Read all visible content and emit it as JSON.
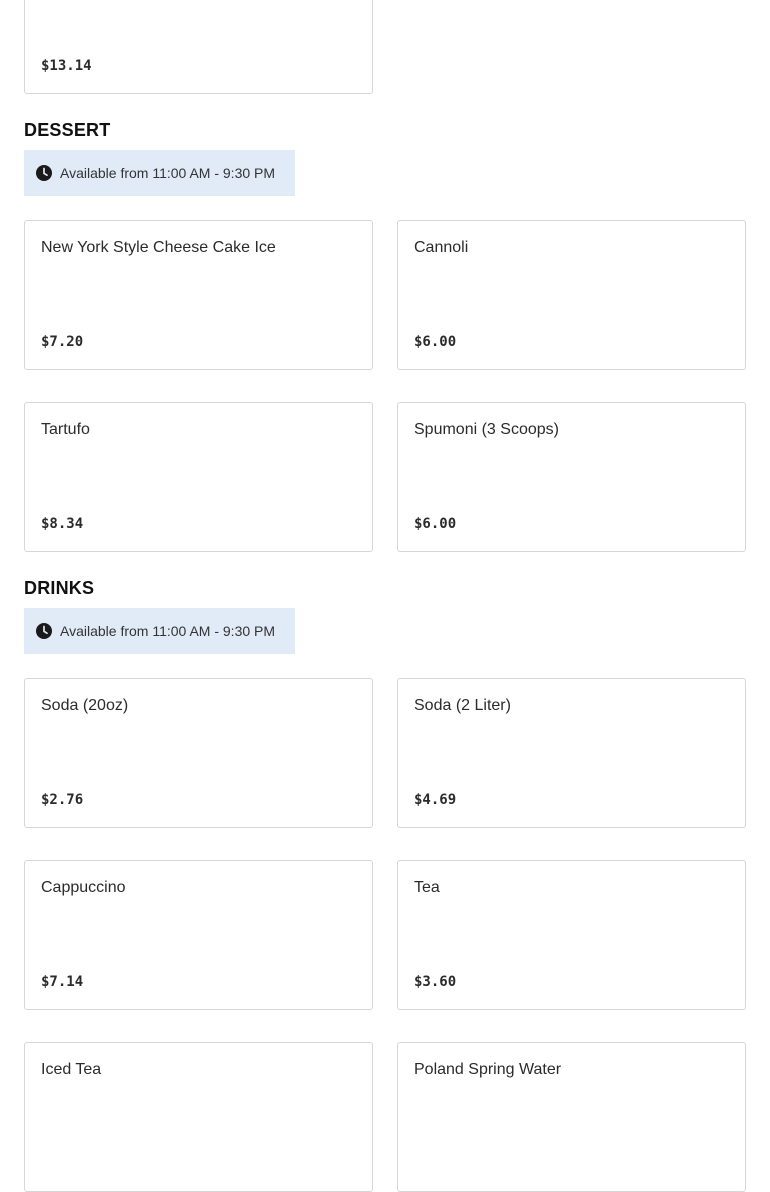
{
  "top_card": {
    "price": "$13.14"
  },
  "dessert": {
    "heading": "DESSERT",
    "availability": "Available from 11:00 AM - 9:30 PM",
    "items": [
      {
        "name": "New York Style Cheese Cake Ice",
        "price": "$7.20"
      },
      {
        "name": "Cannoli",
        "price": "$6.00"
      },
      {
        "name": "Tartufo",
        "price": "$8.34"
      },
      {
        "name": "Spumoni (3 Scoops)",
        "price": "$6.00"
      }
    ]
  },
  "drinks": {
    "heading": "DRINKS",
    "availability": "Available from 11:00 AM - 9:30 PM",
    "items": [
      {
        "name": "Soda (20oz)",
        "price": "$2.76"
      },
      {
        "name": "Soda (2 Liter)",
        "price": "$4.69"
      },
      {
        "name": "Cappuccino",
        "price": "$7.14"
      },
      {
        "name": "Tea",
        "price": "$3.60"
      },
      {
        "name": "Iced Tea",
        "price": ""
      },
      {
        "name": "Poland Spring Water",
        "price": ""
      }
    ]
  },
  "icons": {
    "availability": "clock-icon"
  }
}
